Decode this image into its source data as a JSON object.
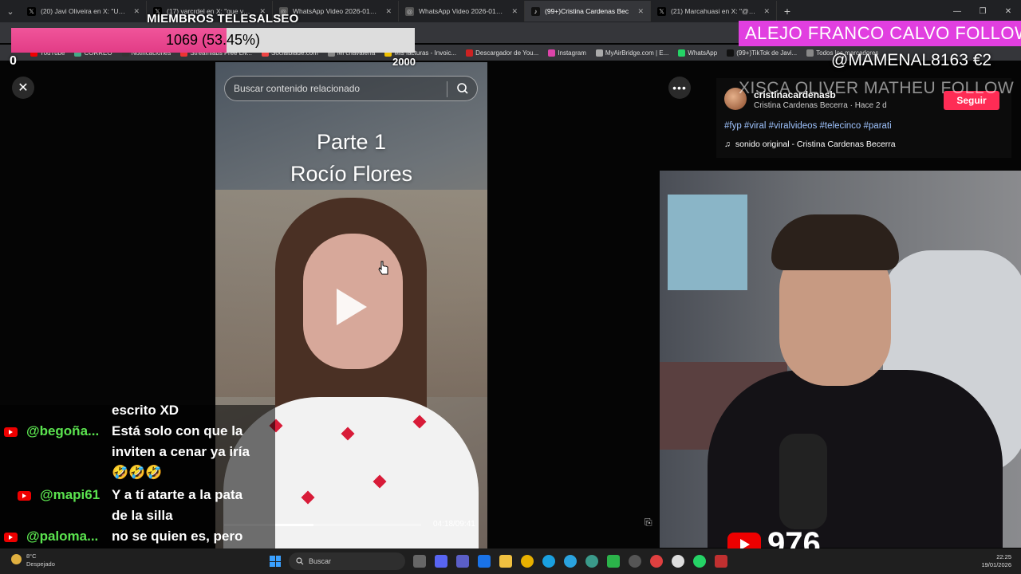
{
  "browser": {
    "tabs": [
      {
        "title": "(20) Javi Oliveira en X: \"Una de",
        "icon": "x-logo-icon"
      },
      {
        "title": "(17) varcrdel en X: \"que van a",
        "icon": "x-logo-icon"
      },
      {
        "title": "WhatsApp Video 2026-01-18 a",
        "icon": "globe-icon"
      },
      {
        "title": "WhatsApp Video 2026-01-18 a",
        "icon": "globe-icon"
      },
      {
        "title": "(99+)Cristina Cardenas Bec",
        "icon": "tiktok-icon",
        "active": true
      },
      {
        "title": "(21) Marcahuasi en X: \"@Salom",
        "icon": "x-logo-icon"
      }
    ],
    "bookmarks": [
      "YouTube",
      "CORREO",
      "Notificaciones",
      "Streamlabs Free Liv...",
      "Socialblade.com",
      "Mi chavalería",
      "Mis facturas - Invoic...",
      "Descargador de You...",
      "Instagram",
      "MyAirBridge.com | E...",
      "WhatsApp",
      "(99+)TikTok de Javi...",
      "Todos los marcadores"
    ]
  },
  "overlay": {
    "goal_title": "MIEMBROS TELESALSEO",
    "goal_text": "1069 (53.45%)",
    "goal_percent": 53.45,
    "goal_min": "0",
    "goal_max": "2000",
    "follow_alert": "ALEJO FRANCO CALVO  FOLLOW",
    "tip_alert": "@MAMENAL8163  €2",
    "ghost_follow": "XISCA OLIVER MATHEU  FOLLOW",
    "viewers": "976"
  },
  "tiktok": {
    "search_placeholder": "Buscar contenido relacionado",
    "video_title_line1": "Parte 1",
    "video_title_line2": "Rocío Flores",
    "progress_fraction": 0.455,
    "time": "04:18/09:41",
    "username": "cristinacardenasb",
    "subline": "Cristina Cardenas Becerra · Hace 2 d",
    "follow_label": "Seguir",
    "hashtags": "#fyp #viral #viralvideos #telecinco #parati",
    "sound": "sonido original - Cristina Cardenas Becerra"
  },
  "chat": {
    "messages": [
      {
        "author": "",
        "lines": [
          "escrito XD"
        ]
      },
      {
        "author": "@begoña...",
        "lines": [
          "Está solo con que la",
          "inviten a cenar ya iría",
          "🤣🤣🤣"
        ]
      },
      {
        "author": "@mapi61",
        "lines": [
          "Y a tí atarte a la pata",
          "de la silla"
        ]
      },
      {
        "author": "@paloma...",
        "lines": [
          "no se quien es, pero",
          "que asco de persona"
        ]
      }
    ],
    "author_color": "#5be34f"
  },
  "taskbar": {
    "temp": "8°C",
    "weather": "Despejado",
    "search_label": "Buscar",
    "time": "22:25",
    "date": "19/01/2026"
  },
  "colors": {
    "goal_fill": "#e23c86",
    "follow_alert_bg": "#e13fe0",
    "tiktok_follow": "#fe2c55",
    "youtube_red": "#ee0000"
  }
}
